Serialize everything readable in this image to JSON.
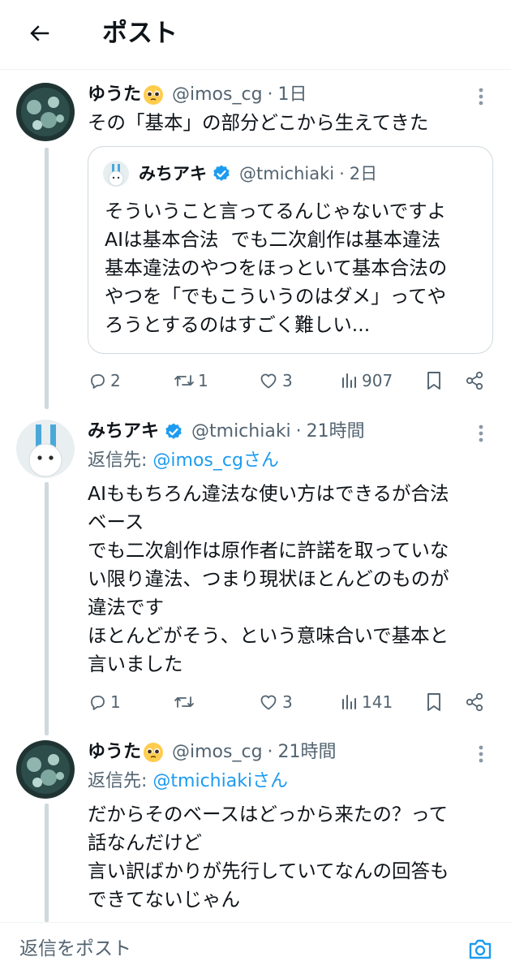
{
  "header": {
    "title": "ポスト",
    "back_icon": "arrow-left-icon"
  },
  "tweets": [
    {
      "display_name": "ゆうた",
      "emoji": "🥺",
      "handle": "@imos_cg",
      "dot": "·",
      "time": "1日",
      "text": "その「基本」の部分どこから生えてきた",
      "quote": {
        "display_name": "みちアキ",
        "handle": "@tmichiaki",
        "dot": "·",
        "time": "2日",
        "text": "そういうこと言ってるんじゃないですよ\nAIは基本合法  でも二次創作は基本違法\n基本違法のやつをほっといて基本合法の\nやつを「でもこういうのはダメ」ってや\nろうとするのはすごく難しい..."
      },
      "stats": {
        "replies": "2",
        "reposts": "1",
        "likes": "3",
        "views": "907"
      }
    },
    {
      "display_name": "みちアキ",
      "handle": "@tmichiaki",
      "dot": "·",
      "time": "21時間",
      "reply_prefix": "返信先: ",
      "reply_mention": "@imos_cgさん",
      "text": "AIももちろん違法な使い方はできるが合法\nベース\nでも二次創作は原作者に許諾を取っていな\nい限り違法、つまり現状ほとんどのものが\n違法です\nほとんどがそう、という意味合いで基本と\n言いました",
      "stats": {
        "replies": "1",
        "reposts": "",
        "likes": "3",
        "views": "141"
      }
    },
    {
      "display_name": "ゆうた",
      "emoji": "🥺",
      "handle": "@imos_cg",
      "dot": "·",
      "time": "21時間",
      "reply_prefix": "返信先: ",
      "reply_mention": "@tmichiakiさん",
      "text": "だからそのベースはどっから来たの？って\n話なんだけど\n言い訳ばかりが先行していてなんの回答も\nできてないじゃん"
    }
  ],
  "reply_bar": {
    "placeholder": "返信をポスト",
    "camera_icon": "camera-icon"
  },
  "colors": {
    "accent": "#1d9bf0",
    "secondary_text": "#536471",
    "border": "#cfd9de"
  }
}
